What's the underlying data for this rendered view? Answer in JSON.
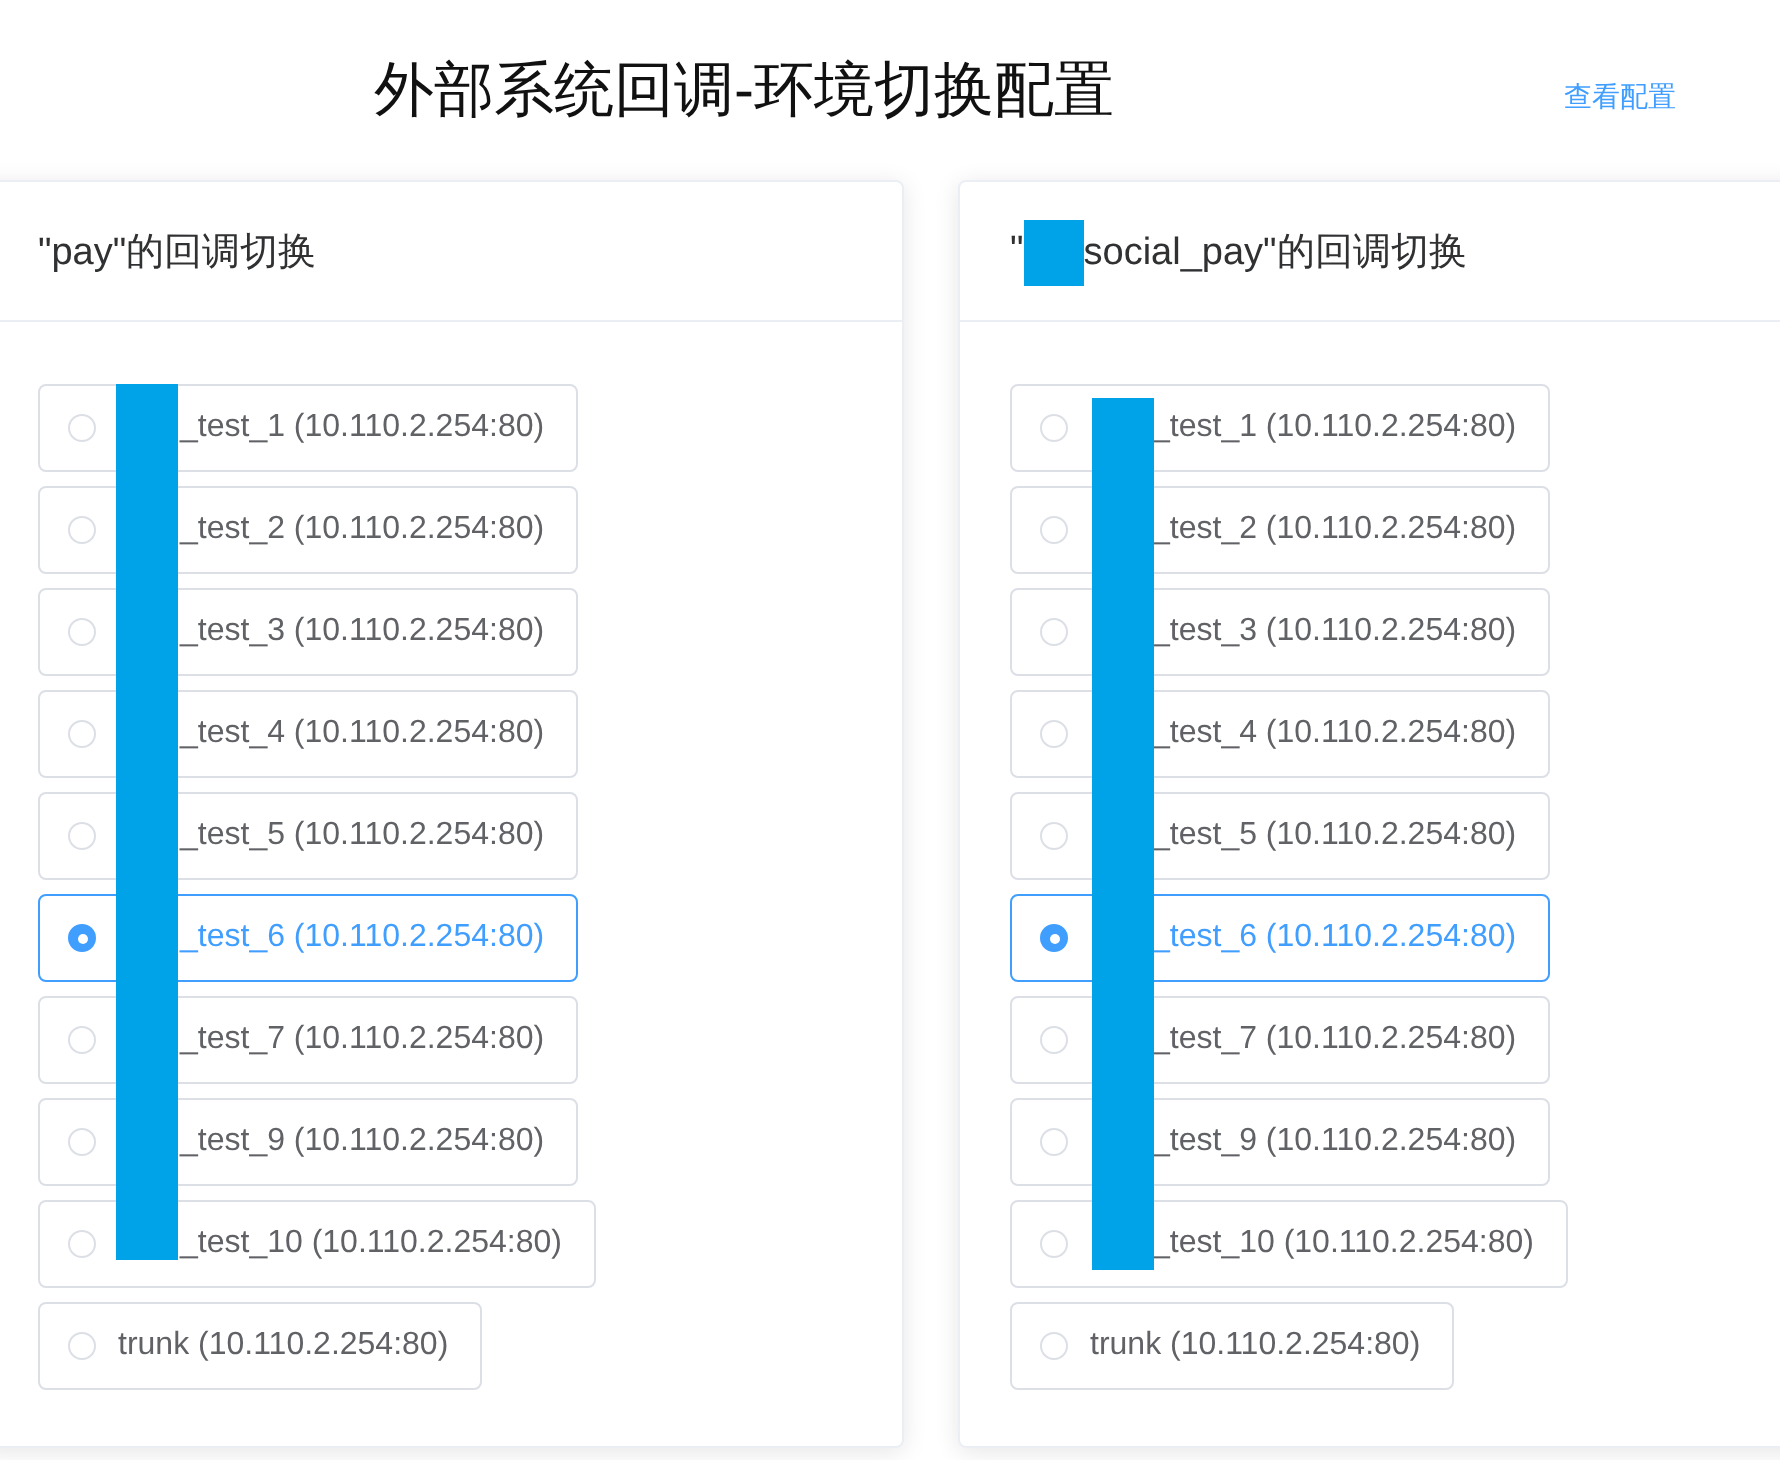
{
  "page_title": "外部系统回调-环境切换配置",
  "view_link": "查看配置",
  "panels": [
    {
      "title_parts": [
        "\"pay\"的回调切换"
      ],
      "options": [
        {
          "label": "_test_1 (10.110.2.254:80)",
          "selected": false,
          "redacted": true
        },
        {
          "label": "_test_2 (10.110.2.254:80)",
          "selected": false,
          "redacted": true
        },
        {
          "label": "_test_3 (10.110.2.254:80)",
          "selected": false,
          "redacted": true
        },
        {
          "label": "_test_4 (10.110.2.254:80)",
          "selected": false,
          "redacted": true
        },
        {
          "label": "_test_5 (10.110.2.254:80)",
          "selected": false,
          "redacted": true
        },
        {
          "label": "_test_6 (10.110.2.254:80)",
          "selected": true,
          "redacted": true
        },
        {
          "label": "_test_7 (10.110.2.254:80)",
          "selected": false,
          "redacted": true
        },
        {
          "label": "_test_9 (10.110.2.254:80)",
          "selected": false,
          "redacted": true
        },
        {
          "label": "_test_10 (10.110.2.254:80)",
          "selected": false,
          "redacted": true
        },
        {
          "label": "trunk (10.110.2.254:80)",
          "selected": false,
          "redacted": false
        }
      ]
    },
    {
      "title_parts": [
        "\"",
        "social_pay\"的回调切换"
      ],
      "options": [
        {
          "label": "_test_1 (10.110.2.254:80)",
          "selected": false,
          "redacted": true
        },
        {
          "label": "_test_2 (10.110.2.254:80)",
          "selected": false,
          "redacted": true
        },
        {
          "label": "_test_3 (10.110.2.254:80)",
          "selected": false,
          "redacted": true
        },
        {
          "label": "_test_4 (10.110.2.254:80)",
          "selected": false,
          "redacted": true
        },
        {
          "label": "_test_5 (10.110.2.254:80)",
          "selected": false,
          "redacted": true
        },
        {
          "label": "_test_6 (10.110.2.254:80)",
          "selected": true,
          "redacted": true
        },
        {
          "label": "_test_7 (10.110.2.254:80)",
          "selected": false,
          "redacted": true
        },
        {
          "label": "_test_9 (10.110.2.254:80)",
          "selected": false,
          "redacted": true
        },
        {
          "label": "_test_10 (10.110.2.254:80)",
          "selected": false,
          "redacted": true
        },
        {
          "label": "trunk (10.110.2.254:80)",
          "selected": false,
          "redacted": false
        }
      ]
    }
  ]
}
